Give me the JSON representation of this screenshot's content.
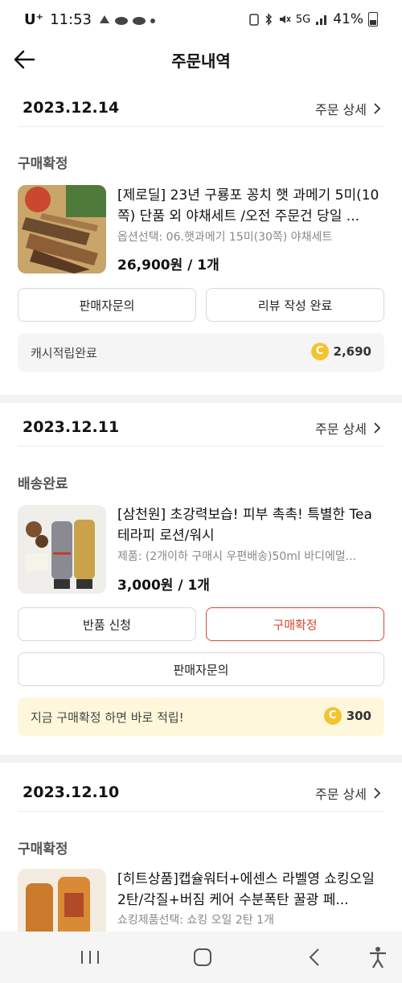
{
  "status_bar": {
    "carrier": "U⁺",
    "time": "11:53",
    "network": "5G",
    "battery": "41%"
  },
  "header": {
    "title": "주문내역"
  },
  "orders": [
    {
      "date": "2023.12.14",
      "detail_label": "주문 상세",
      "status": "구매확정",
      "product_title": "[제로딜] 23년 구룡포 꽁치 햇 과메기 5미(10쪽) 단품 외 야채세트 /오전 주문건 당일 ...",
      "product_option": "옵션선택: 06.햇과메기 15미(30쪽) 야채세트",
      "price_qty": "26,900원 / 1개",
      "buttons": [
        "판매자문의",
        "리뷰 작성 완료"
      ],
      "info_text": "캐시적립완료",
      "coin_symbol": "C",
      "coin_amount": "2,690"
    },
    {
      "date": "2023.12.11",
      "detail_label": "주문 상세",
      "status": "배송완료",
      "product_title": "[삼천원] 초강력보습! 피부 촉촉! 특별한 Tea 테라피 로션/워시",
      "product_option": "제품: (2개이하 구매시 우편배송)50ml 바디에멀...",
      "price_qty": "3,000원 / 1개",
      "buttons": [
        "반품 신청",
        "구매확정",
        "판매자문의"
      ],
      "info_text": "지금 구매확정 하면 바로 적립!",
      "coin_symbol": "C",
      "coin_amount": "300"
    },
    {
      "date": "2023.12.10",
      "detail_label": "주문 상세",
      "status": "구매확정",
      "product_title": "[히트상품]캡슐워터+에센스 라벨영 쇼킹오일 2탄/각질+버짐 케어 수분폭탄 꿀광 페...",
      "product_option": "쇼킹제품선택: 쇼킹 오일 2탄 1개"
    }
  ],
  "colors": {
    "accent": "#d24a2f",
    "coin": "#f4c430",
    "info_yellow": "#fff7dc"
  },
  "icons": {
    "back": "arrow-left-icon",
    "chevron": "chevron-right-icon",
    "nav": [
      "recent-apps-icon",
      "home-icon",
      "back-icon",
      "accessibility-icon"
    ]
  }
}
